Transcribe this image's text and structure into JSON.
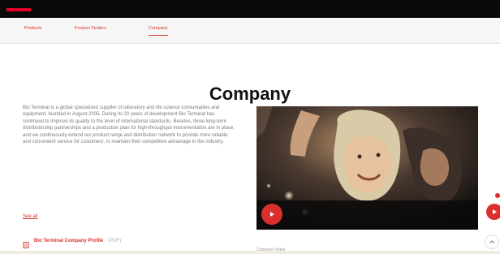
{
  "subnav": {
    "items": [
      {
        "label": "Products"
      },
      {
        "label": "Product Finders"
      },
      {
        "label": "Company"
      }
    ]
  },
  "page_title": "Company",
  "intro_text": "Bio Terminal is a global specialized supplier of laboratory and life science consumables and equipment, founded in August 2005. During its 20 years of development Bio Terminal has continued to improve its quality to the level of international standards. Besides, three long-term distributorship partnerships and a production plan for high-throughput instrumentation are in place, and we continuously extend our product range and distribution network to provide more reliable and convenient service for customers, to maintain their competitive advantage in the industry.",
  "more_link": "See all",
  "profile": {
    "label": "Bio Terminal Company Profile",
    "size": "(PDF)"
  },
  "video_caption": "Company Video",
  "icons": {
    "pdf": "pdf-icon",
    "play": "play-icon",
    "scroll_top": "chevron-up-icon"
  },
  "colors": {
    "accent": "#d9302b",
    "topbar": "#0a0a0a"
  }
}
